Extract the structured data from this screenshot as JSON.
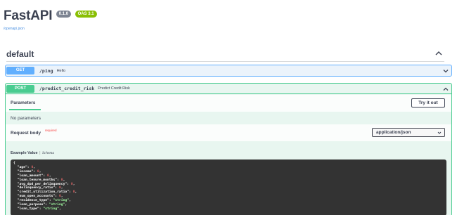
{
  "header": {
    "title": "FastAPI",
    "version_badge": "0.1.0",
    "oas_badge": "OAS 3.1",
    "openapi_link": "/openapi.json"
  },
  "tag": {
    "name": "default"
  },
  "operations": [
    {
      "method": "GET",
      "path": "/ping",
      "summary": "Hello"
    },
    {
      "method": "POST",
      "path": "/predict_credit_risk",
      "summary": "Predict Credit Risk"
    }
  ],
  "post_details": {
    "parameters_tab": "Parameters",
    "try_button": "Try it out",
    "no_params": "No parameters",
    "request_body_label": "Request body",
    "required_label": "required",
    "content_type": "application/json",
    "example_value_label": "Example Value",
    "separator": "|",
    "schema_label": "Schema",
    "example_open": "{",
    "example_fields": [
      {
        "key": "\"age\"",
        "value": "0",
        "kind": "n"
      },
      {
        "key": "\"income\"",
        "value": "0",
        "kind": "n"
      },
      {
        "key": "\"loan_amount\"",
        "value": "0",
        "kind": "n"
      },
      {
        "key": "\"loan_tenure_months\"",
        "value": "0",
        "kind": "n"
      },
      {
        "key": "\"avg_dpd_per_delinquency\"",
        "value": "0",
        "kind": "n"
      },
      {
        "key": "\"delinquency_ratio\"",
        "value": "0",
        "kind": "n"
      },
      {
        "key": "\"credit_utilization_ratio\"",
        "value": "0",
        "kind": "n"
      },
      {
        "key": "\"num_open_accounts\"",
        "value": "0",
        "kind": "n"
      },
      {
        "key": "\"residence_type\"",
        "value": "\"string\"",
        "kind": "s"
      },
      {
        "key": "\"loan_purpose\"",
        "value": "\"string\"",
        "kind": "s"
      },
      {
        "key": "\"loan_type\"",
        "value": "\"string\"",
        "kind": "s"
      }
    ]
  },
  "colors": {
    "get": "#61affe",
    "post": "#49cc90",
    "code_bg": "#333333",
    "version_badge": "#7d8492",
    "oas_badge": "#89bf04"
  }
}
